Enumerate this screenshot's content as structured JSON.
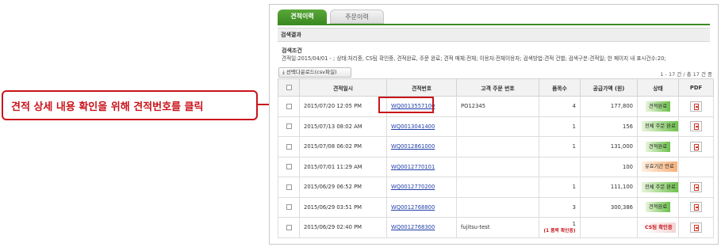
{
  "callout": {
    "text": "견적 상세 내용 확인을 위해 견적번호를 클릭"
  },
  "tabs": [
    {
      "label": "견적이력",
      "active": true
    },
    {
      "label": "주문이력",
      "active": false
    }
  ],
  "section": {
    "title": "검색결과"
  },
  "conditions": {
    "title": "검색조건",
    "text": "견적일:2015/04/01 - ; 상태:처리중, CS팀 확인중, 견적완료, 주문 완료; 견적 매체:전체; 이용자:전체이용자; 검색방법:견적 건별; 검색구분:견적일; 한 페이지 내 표시건수:20;"
  },
  "download_button": {
    "label": "선택다운로드(csv파일)",
    "icon": "download-icon"
  },
  "paging": {
    "text": "1 - 17 건 / 총 17 건 중"
  },
  "table": {
    "headers": [
      "",
      "견적일시",
      "견적번호",
      "고객 주문 번호",
      "품목수",
      "공급가액 (원)",
      "상태",
      "PDF"
    ],
    "rows": [
      {
        "date": "2015/07/20 12:05 PM",
        "quote": "WQ0013557100",
        "order": "PO12345",
        "items": "4",
        "items_note": "",
        "amount": "177,800",
        "status": "견적완료",
        "status_type": "green"
      },
      {
        "date": "2015/07/13 08:02 AM",
        "quote": "WQ0013041400",
        "order": "",
        "items": "1",
        "items_note": "",
        "amount": "156",
        "status": "전체 주문 완료",
        "status_type": "green-arrow"
      },
      {
        "date": "2015/07/08 06:02 PM",
        "quote": "WQ0012861000",
        "order": "",
        "items": "1",
        "items_note": "",
        "amount": "131,000",
        "status": "견적완료",
        "status_type": "green"
      },
      {
        "date": "2015/07/01 11:29 AM",
        "quote": "WQ0012770101",
        "order": "",
        "items": "",
        "items_note": "",
        "amount": "100",
        "status": "유효기간 만료",
        "status_type": "orange"
      },
      {
        "date": "2015/06/29 06:52 PM",
        "quote": "WQ0012770200",
        "order": "",
        "items": "1",
        "items_note": "",
        "amount": "111,100",
        "status": "전체 주문 완료",
        "status_type": "green-arrow"
      },
      {
        "date": "2015/06/29 03:51 PM",
        "quote": "WQ0012768800",
        "order": "",
        "items": "3",
        "items_note": "",
        "amount": "300,386",
        "status": "견적완료",
        "status_type": "green"
      },
      {
        "date": "2015/06/29 02:40 PM",
        "quote": "WQ0012768300",
        "order": "fujitsu-test",
        "items": "1",
        "items_note": "(1 품목 확인중)",
        "amount": "",
        "status": "CS팀 확인중",
        "status_type": "cs"
      }
    ]
  },
  "colors": {
    "accent_green": "#3c8a22",
    "callout_red": "#c8141b",
    "link_blue": "#1f3fa8"
  }
}
